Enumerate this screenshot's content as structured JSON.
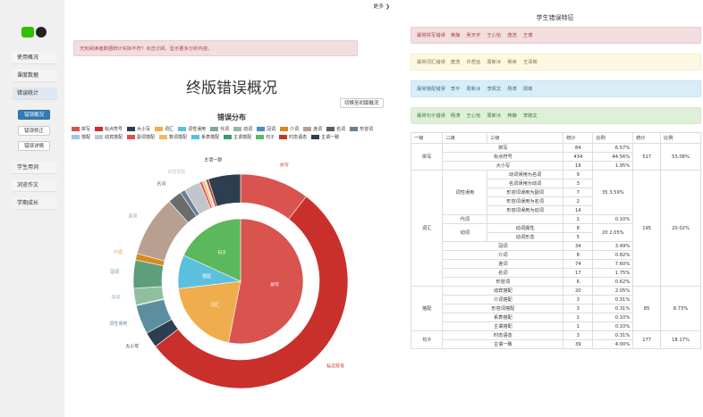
{
  "sidebar": {
    "items": [
      "使用概况",
      "课度数据",
      "错误统计",
      "学生用词",
      "浏览作文",
      "学期成长"
    ],
    "sub": [
      "错误概况",
      "错误修正",
      "错误详情"
    ]
  },
  "topbar": {
    "more": "更多 ❯"
  },
  "mid": {
    "alert": "无刻阅读者数据统计实际不符？点击订阅，显示更多分析内容。",
    "title": "终版错误概况",
    "switch_btn": "切换至初版概况",
    "chart_title": "错误分布"
  },
  "chart_data": {
    "type": "pie",
    "title": "错误分布",
    "legend": [
      {
        "name": "拼写",
        "color": "#d9534f"
      },
      {
        "name": "标点符号",
        "color": "#c9302c"
      },
      {
        "name": "大小写",
        "color": "#2c3e50"
      },
      {
        "name": "词汇",
        "color": "#f0ad4e"
      },
      {
        "name": "词性误用",
        "color": "#5bc0de"
      },
      {
        "name": "代词",
        "color": "#7ca9a8"
      },
      {
        "name": "动词",
        "color": "#8fbf9f"
      },
      {
        "name": "冠词",
        "color": "#4a8fb7"
      },
      {
        "name": "介词",
        "color": "#d68b1c"
      },
      {
        "name": "连词",
        "color": "#b8a090"
      },
      {
        "name": "名词",
        "color": "#5e5e5e"
      },
      {
        "name": "形容词",
        "color": "#6c8096"
      },
      {
        "name": "搭配",
        "color": "#9ec6e6"
      },
      {
        "name": "动宾搭配",
        "color": "#c0c6cc"
      },
      {
        "name": "副词搭配",
        "color": "#e44d4d"
      },
      {
        "name": "数词搭配",
        "color": "#f3b866"
      },
      {
        "name": "系表搭配",
        "color": "#5bc0de"
      },
      {
        "name": "主谓搭配",
        "color": "#3d9970"
      },
      {
        "name": "句子",
        "color": "#5cb85c"
      },
      {
        "name": "时态语态",
        "color": "#c0392b"
      },
      {
        "name": "主谓一致",
        "color": "#2c3e50"
      }
    ],
    "outer": [
      {
        "name": "拼写",
        "value": 84,
        "color": "#d9534f"
      },
      {
        "name": "标点符号",
        "value": 434,
        "color": "#c9302c"
      },
      {
        "name": "大小写",
        "value": 19,
        "color": "#2c3e50"
      },
      {
        "name": "词性误用",
        "value": 35,
        "color": "#5b8fa0"
      },
      {
        "name": "代词",
        "value": 1,
        "color": "#7ca9a8"
      },
      {
        "name": "动词",
        "value": 20,
        "color": "#8fbf9f"
      },
      {
        "name": "冠词",
        "value": 34,
        "color": "#5e9e7a"
      },
      {
        "name": "介词",
        "value": 8,
        "color": "#d68b1c"
      },
      {
        "name": "连词",
        "value": 74,
        "color": "#b8a090"
      },
      {
        "name": "名词",
        "value": 17,
        "color": "#6b6b6b"
      },
      {
        "name": "形容词",
        "value": 6,
        "color": "#6c8096"
      },
      {
        "name": "动宾搭配",
        "value": 20,
        "color": "#c0c6cc"
      },
      {
        "name": "介词搭配",
        "value": 3,
        "color": "#e44d4d"
      },
      {
        "name": "形容词搭配",
        "value": 3,
        "color": "#f3b866"
      },
      {
        "name": "系表搭配",
        "value": 1,
        "color": "#5bc0de"
      },
      {
        "name": "主谓搭配",
        "value": 1,
        "color": "#3d9970"
      },
      {
        "name": "时态语态",
        "value": 3,
        "color": "#c0392b"
      },
      {
        "name": "主谓一致",
        "value": 39,
        "color": "#2c3e50"
      }
    ],
    "inner": [
      {
        "name": "拼写",
        "value": 517,
        "color": "#d9534f"
      },
      {
        "name": "词汇",
        "value": 195,
        "color": "#f0ad4e"
      },
      {
        "name": "搭配",
        "value": 85,
        "color": "#5bc0de"
      },
      {
        "name": "句子",
        "value": 177,
        "color": "#5cb85c"
      }
    ]
  },
  "right": {
    "title": "学生错误特征",
    "groups": [
      {
        "label": "最常拼写错误",
        "names": [
          "蒋静",
          "吴天宇",
          "王心怡",
          "唐浩",
          "王博"
        ],
        "bg": "#f2dede",
        "border": "#ebccd1",
        "color": "#a94442"
      },
      {
        "label": "最常词汇错误",
        "names": [
          "唐浩",
          "许哲远",
          "周新冰",
          "吴英",
          "王泽岗"
        ],
        "bg": "#fcf8e3",
        "border": "#faebcc",
        "color": "#8a6d3b"
      },
      {
        "label": "最常搭配错误",
        "names": [
          "李平",
          "周新冰",
          "李佩文",
          "杨涛",
          "周锋"
        ],
        "bg": "#d9edf7",
        "border": "#bce8f1",
        "color": "#31708f"
      },
      {
        "label": "最常句子错误",
        "names": [
          "杨涛",
          "王心怡",
          "周新冰",
          "蒋静",
          "李婉文"
        ],
        "bg": "#dff0d8",
        "border": "#d6e9c6",
        "color": "#3c763d"
      }
    ],
    "table": {
      "headers": [
        "一级",
        "二级",
        "三级",
        "统计",
        "比例",
        "统计",
        "比例"
      ],
      "spell": {
        "l1": "拼写",
        "rows": [
          [
            "拼写",
            "84",
            "6.57%"
          ],
          [
            "标点符号",
            "434",
            "44.56%"
          ],
          [
            "大小写",
            "19",
            "1.95%"
          ]
        ],
        "count": "517",
        "ratio": "53.08%"
      },
      "vocab": {
        "l1": "词汇",
        "count": "195",
        "ratio": "20.02%",
        "pos": {
          "l2": "词性误用",
          "count": "35",
          "ratio": "3.59%",
          "rows": [
            [
              "动词误用为名词",
              "9"
            ],
            [
              "名词误用为动词",
              "3"
            ],
            [
              "形容词误用为副词",
              "7"
            ],
            [
              "形容词误用为名词",
              "2"
            ],
            [
              "形容词误用为动词",
              "14"
            ]
          ]
        },
        "pron": {
          "l2": "代词",
          "count": "1",
          "ratio": "0.10%"
        },
        "verb": {
          "l2": "动词",
          "count": "20",
          "ratio": "2.05%",
          "rows": [
            [
              "动词属性",
              "8"
            ],
            [
              "动词形态",
              "5"
            ]
          ]
        },
        "rest": [
          [
            "冠词",
            "34",
            "3.49%"
          ],
          [
            "介词",
            "8",
            "0.82%"
          ],
          [
            "连词",
            "74",
            "7.60%"
          ],
          [
            "名词",
            "17",
            "1.75%"
          ],
          [
            "形容词",
            "6",
            "0.62%"
          ]
        ]
      },
      "colloc": {
        "l1": "搭配",
        "count": "85",
        "ratio": "8.73%",
        "rows": [
          [
            "动宾搭配",
            "20",
            "2.05%"
          ],
          [
            "介词搭配",
            "3",
            "0.31%"
          ],
          [
            "形容词搭配",
            "3",
            "0.31%"
          ],
          [
            "系表搭配",
            "1",
            "0.10%"
          ],
          [
            "主谓搭配",
            "1",
            "0.10%"
          ]
        ]
      },
      "sent": {
        "l1": "句子",
        "count": "177",
        "ratio": "18.17%",
        "rows": [
          [
            "时态语态",
            "3",
            "0.31%"
          ],
          [
            "主谓一致",
            "39",
            "4.00%"
          ]
        ]
      }
    }
  }
}
